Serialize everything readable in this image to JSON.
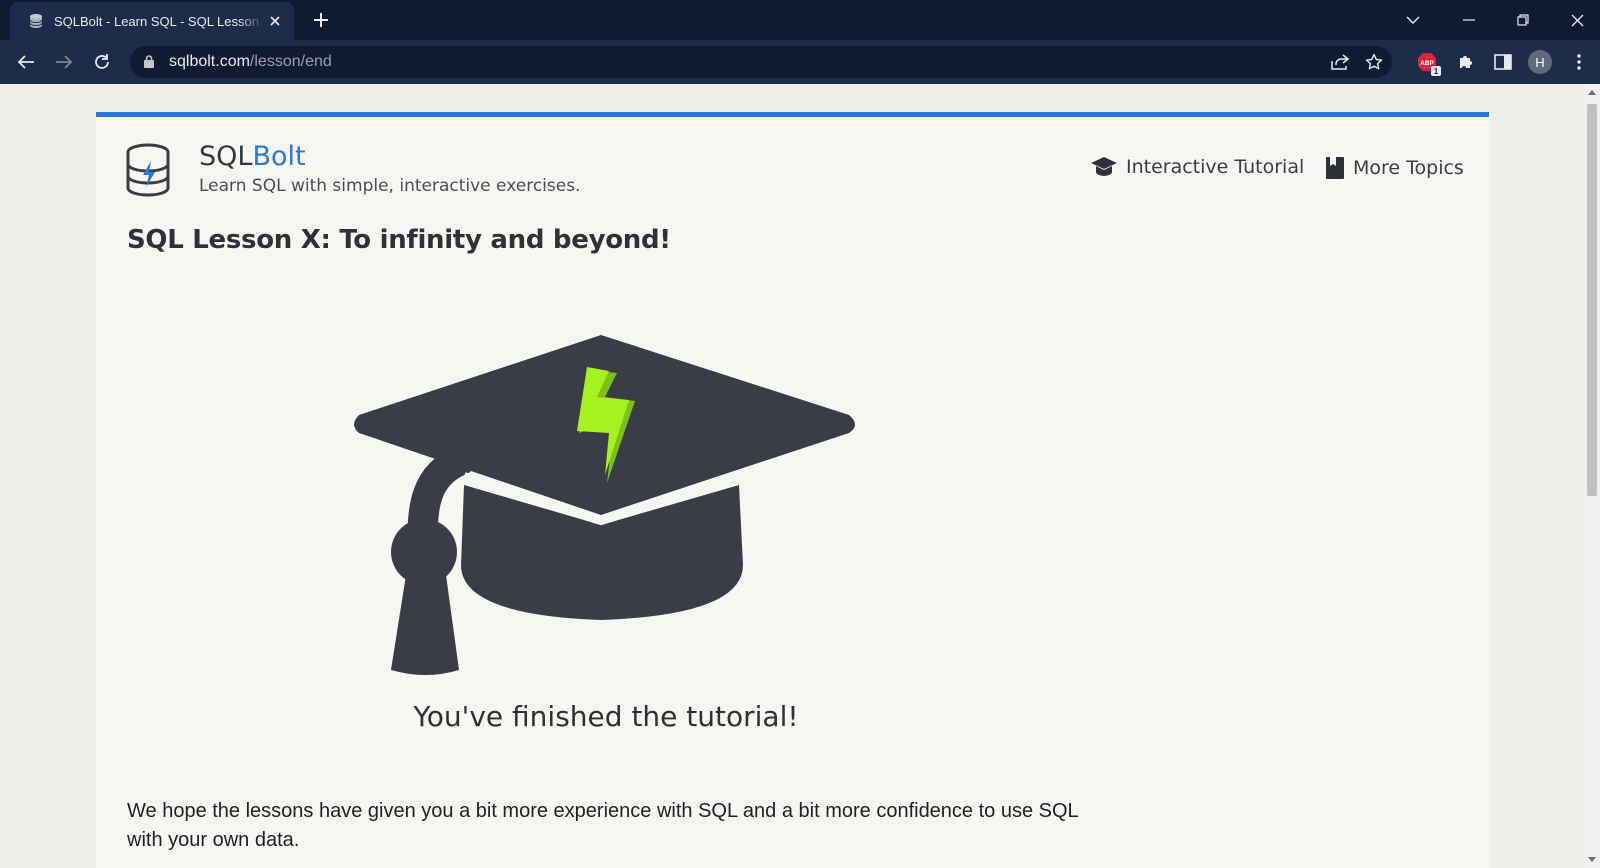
{
  "browser": {
    "tab_title": "SQLBolt - Learn SQL - SQL Lesson X: To infinity and beyond!",
    "url_domain": "sqlbolt.com",
    "url_path": "/lesson/end",
    "profile_initial": "H",
    "extension_badge": "1"
  },
  "site": {
    "brand_prefix": "SQL",
    "brand_accent": "Bolt",
    "tagline": "Learn SQL with simple, interactive exercises.",
    "nav": {
      "tutorial": "Interactive Tutorial",
      "topics": "More Topics"
    },
    "accent_color": "#2b78d6"
  },
  "lesson": {
    "title": "SQL Lesson X: To infinity and beyond!",
    "finished": "You've finished the tutorial!",
    "paragraph": "We hope the lessons have given you a bit more experience with SQL and a bit more confidence to use SQL with your own data."
  }
}
